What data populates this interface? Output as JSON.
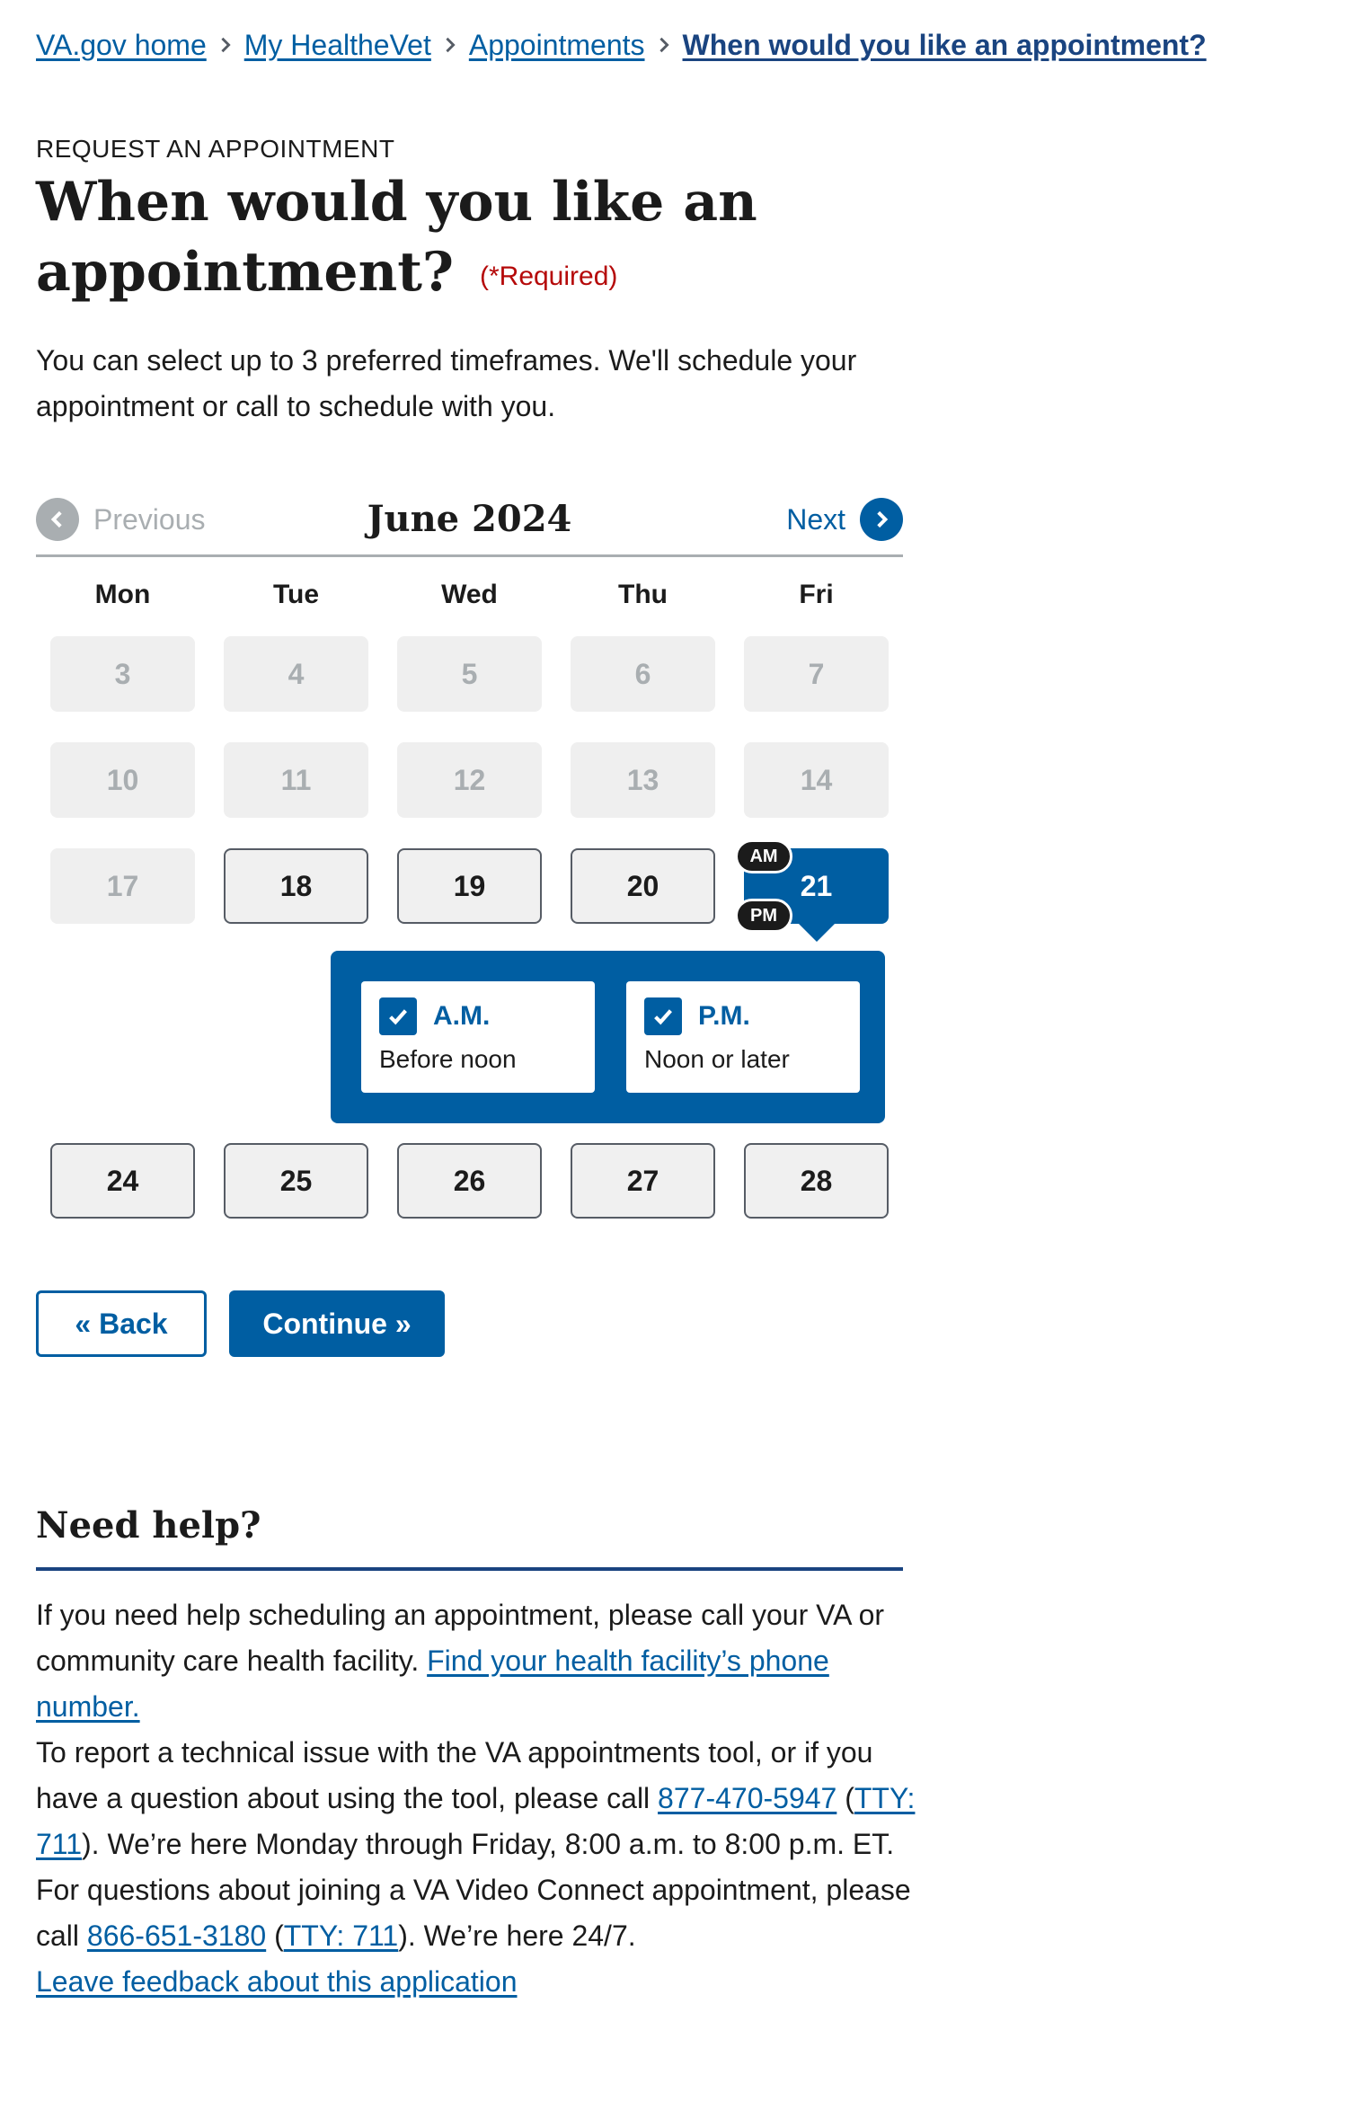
{
  "breadcrumb": {
    "items": [
      "VA.gov home",
      "My HealtheVet",
      "Appointments",
      "When would you like an appointment?"
    ]
  },
  "header": {
    "eyebrow": "REQUEST AN APPOINTMENT",
    "title": "When would you like an appointment?",
    "required": "(*Required)",
    "intro": "You can select up to 3 preferred timeframes. We'll schedule your appointment or call to schedule with you."
  },
  "calendar": {
    "prev_label": "Previous",
    "next_label": "Next",
    "month": "June 2024",
    "weekdays": [
      "Mon",
      "Tue",
      "Wed",
      "Thu",
      "Fri"
    ],
    "week1": [
      "3",
      "4",
      "5",
      "6",
      "7"
    ],
    "week2": [
      "10",
      "11",
      "12",
      "13",
      "14"
    ],
    "week3": [
      "17",
      "18",
      "19",
      "20",
      "21"
    ],
    "week4": [
      "24",
      "25",
      "26",
      "27",
      "28"
    ],
    "selected_badges": [
      "AM",
      "PM"
    ],
    "options": [
      {
        "label": "A.M.",
        "desc": "Before noon",
        "checked": true
      },
      {
        "label": "P.M.",
        "desc": "Noon or later",
        "checked": true
      }
    ]
  },
  "actions": {
    "back": "« Back",
    "continue": "Continue »"
  },
  "help": {
    "title": "Need help?",
    "p1_text": "If you need help scheduling an appointment, please call your VA or community care health facility. ",
    "p1_link": "Find your health facility’s phone number.",
    "p2_a": "To report a technical issue with the VA appointments tool, or if you have a question about using the tool, please call ",
    "p2_phone": "877-470-5947",
    "p2_b": " (",
    "p2_tty": "TTY: 711",
    "p2_c": "). We’re here Monday through Friday, 8:00 a.m. to 8:00 p.m. ET.",
    "p3_a": "For questions about joining a VA Video Connect appointment, please call ",
    "p3_phone": "866-651-3180",
    "p3_b": " (",
    "p3_tty": "TTY: 711",
    "p3_c": "). We’re here 24/7.",
    "feedback": "Leave feedback about this application"
  },
  "colors": {
    "primary": "#005ea2",
    "primary_dark": "#1a4480",
    "required": "#b50909",
    "disabled_bg": "#efefef",
    "disabled_text": "#a9aeb1"
  }
}
